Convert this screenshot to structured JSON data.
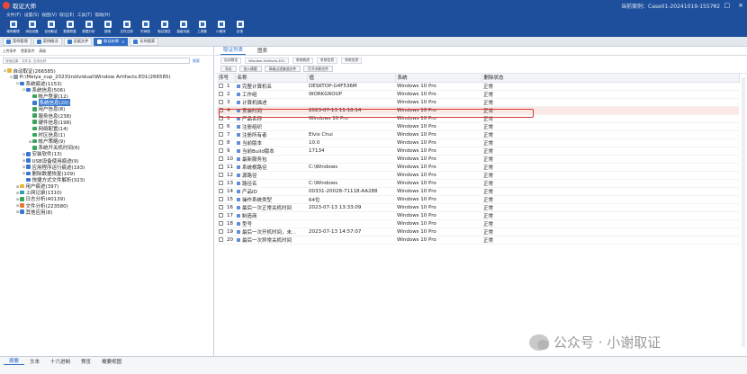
{
  "app": {
    "title": "取证大师",
    "case_label": "当前案例：Case01-20241019-155702"
  },
  "menu": [
    "文件(F)",
    "设置(S)",
    "视图(V)",
    "取证(E)",
    "工具(T)",
    "帮助(H)"
  ],
  "toolbar": [
    "案例管理",
    "添加设备",
    "自动取证",
    "数据恢复",
    "数据分析",
    "搜索",
    "文件过滤",
    "时间线",
    "取证报告",
    "高级功能",
    "工具集",
    "小程序",
    "反馈"
  ],
  "tabs": [
    {
      "label": "案例管理"
    },
    {
      "label": "案例概况"
    },
    {
      "label": "证据文件"
    },
    {
      "label": "取证结果"
    },
    {
      "label": "实时搜索"
    }
  ],
  "left": {
    "tools": [
      "上传条件",
      "检索条件",
      "高级"
    ],
    "search_placeholder": "搜索结果：文件名, 应用名称",
    "search_button": "搜索",
    "tree": [
      {
        "label": "自动取证(266585)",
        "level": 0,
        "exp": "-",
        "icon": "folder"
      },
      {
        "label": "H:\\Meiya_cup_2023\\Individual\\Window Artifacts.E01(266585)",
        "level": 1,
        "exp": "-",
        "icon": "drive"
      },
      {
        "label": "系统痕迹(1153)",
        "level": 2,
        "exp": "-",
        "icon": "blue"
      },
      {
        "label": "系统信息(506)",
        "level": 3,
        "exp": "-",
        "icon": "blue"
      },
      {
        "label": "帐户登录(12)",
        "level": 4,
        "exp": "",
        "icon": "green"
      },
      {
        "label": "系统信息(20)",
        "level": 4,
        "exp": "",
        "icon": "blue",
        "selected": true
      },
      {
        "label": "用户信息(8)",
        "level": 4,
        "exp": "",
        "icon": "green"
      },
      {
        "label": "服务信息(238)",
        "level": 4,
        "exp": "",
        "icon": "green"
      },
      {
        "label": "硬件信息(198)",
        "level": 4,
        "exp": "",
        "icon": "green"
      },
      {
        "label": "网络配置(14)",
        "level": 4,
        "exp": "",
        "icon": "green"
      },
      {
        "label": "时区信息(1)",
        "level": 4,
        "exp": "",
        "icon": "green"
      },
      {
        "label": "帐户策略(9)",
        "level": 4,
        "exp": "+",
        "icon": "green"
      },
      {
        "label": "系统开关机时间(6)",
        "level": 4,
        "exp": "",
        "icon": "green"
      },
      {
        "label": "安装软件(13)",
        "level": 3,
        "exp": "+",
        "icon": "blue"
      },
      {
        "label": "USB设备使用痕迹(9)",
        "level": 3,
        "exp": "+",
        "icon": "blue"
      },
      {
        "label": "应用程序运行痕迹(193)",
        "level": 3,
        "exp": "+",
        "icon": "blue"
      },
      {
        "label": "删除数据恢复(109)",
        "level": 3,
        "exp": "+",
        "icon": "blue"
      },
      {
        "label": "快捷方式文件解析(323)",
        "level": 3,
        "exp": "",
        "icon": "blue"
      },
      {
        "label": "用户痕迹(397)",
        "level": 2,
        "exp": "+",
        "icon": "folder"
      },
      {
        "label": "上网记录(1310)",
        "level": 2,
        "exp": "+",
        "icon": "teal"
      },
      {
        "label": "日志分析(40139)",
        "level": 2,
        "exp": "+",
        "icon": "green"
      },
      {
        "label": "文件分析(223580)",
        "level": 2,
        "exp": "+",
        "icon": "orange"
      },
      {
        "label": "其他应用(8)",
        "level": 2,
        "exp": "+",
        "icon": "blue"
      }
    ]
  },
  "right": {
    "tabs": [
      "取证列表",
      "图表"
    ],
    "breadcrumb": [
      "自动取证",
      "Window Artifacts.E01",
      "系统痕迹",
      "系统信息",
      "系统信息"
    ],
    "actions": [
      "导出",
      "加入摘要",
      "高级过滤复选文件",
      "打开关联文件"
    ],
    "columns": [
      "序号",
      "名称",
      "值",
      "系统",
      "删除状态"
    ],
    "rows": [
      [
        "1",
        "完整计算机名",
        "DESKTOP-G4F536M",
        "Windows 10 Pro",
        "正常"
      ],
      [
        "2",
        "工作组",
        "WORKGROUP",
        "Windows 10 Pro",
        "正常"
      ],
      [
        "3",
        "计算机描述",
        "",
        "Windows 10 Pro",
        "正常"
      ],
      [
        "4",
        "安装时间",
        "2023-07-13 11:18:14",
        "Windows 10 Pro",
        "正常"
      ],
      [
        "5",
        "产品名称",
        "Windows 10 Pro",
        "Windows 10 Pro",
        "正常"
      ],
      [
        "6",
        "注册组织",
        "",
        "Windows 10 Pro",
        "正常"
      ],
      [
        "7",
        "注册所有者",
        "Elvis Chui",
        "Windows 10 Pro",
        "正常"
      ],
      [
        "8",
        "当前版本",
        "10.0",
        "Windows 10 Pro",
        "正常"
      ],
      [
        "9",
        "当前Build版本",
        "17134",
        "Windows 10 Pro",
        "正常"
      ],
      [
        "10",
        "最新服务包",
        "",
        "Windows 10 Pro",
        "正常"
      ],
      [
        "11",
        "系统根路径",
        "C:\\Windows",
        "Windows 10 Pro",
        "正常"
      ],
      [
        "12",
        "源路径",
        "",
        "Windows 10 Pro",
        "正常"
      ],
      [
        "13",
        "路径名",
        "C:\\Windows",
        "Windows 10 Pro",
        "正常"
      ],
      [
        "14",
        "产品ID",
        "00331-20028-71118-AA288",
        "Windows 10 Pro",
        "正常"
      ],
      [
        "15",
        "操作系统类型",
        "64位",
        "Windows 10 Pro",
        "正常"
      ],
      [
        "16",
        "最后一次正常关机时间",
        "2023-07-13 13:33:09",
        "Windows 10 Pro",
        "正常"
      ],
      [
        "17",
        "制造商",
        "",
        "Windows 10 Pro",
        "正常"
      ],
      [
        "18",
        "型号",
        "",
        "Windows 10 Pro",
        "正常"
      ],
      [
        "19",
        "最后一次开机时间，未...",
        "2023-07-13 14:57:07",
        "Windows 10 Pro",
        "正常"
      ],
      [
        "20",
        "最后一次异常关机时间",
        "",
        "Windows 10 Pro",
        "正常"
      ]
    ]
  },
  "bottom_tabs": [
    "摘要",
    "文本",
    "十六进制",
    "预览",
    "概要视图"
  ],
  "watermark": "公众号 · 小谢取证",
  "colors": {
    "brand": "#1e4f9c",
    "accent": "#2f6dc7",
    "highlight": "#d9372d"
  }
}
